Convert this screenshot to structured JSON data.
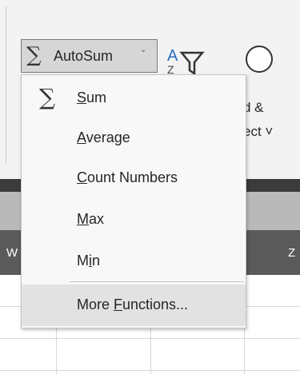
{
  "ribbon": {
    "autosum_label": "AutoSum",
    "find_select_line1": "d &",
    "find_select_line2": "ect ˅"
  },
  "columns": [
    "W",
    "Z"
  ],
  "menu": {
    "items": [
      {
        "label": "Sum",
        "icon": "sigma-icon",
        "accel": "S"
      },
      {
        "label": "Average",
        "accel": "A"
      },
      {
        "label": "Count Numbers",
        "accel": "C"
      },
      {
        "label": "Max",
        "accel": "M"
      },
      {
        "label": "Min",
        "accel": "i"
      },
      {
        "label": "More Functions...",
        "accel": "F",
        "highlighted": true
      }
    ]
  }
}
